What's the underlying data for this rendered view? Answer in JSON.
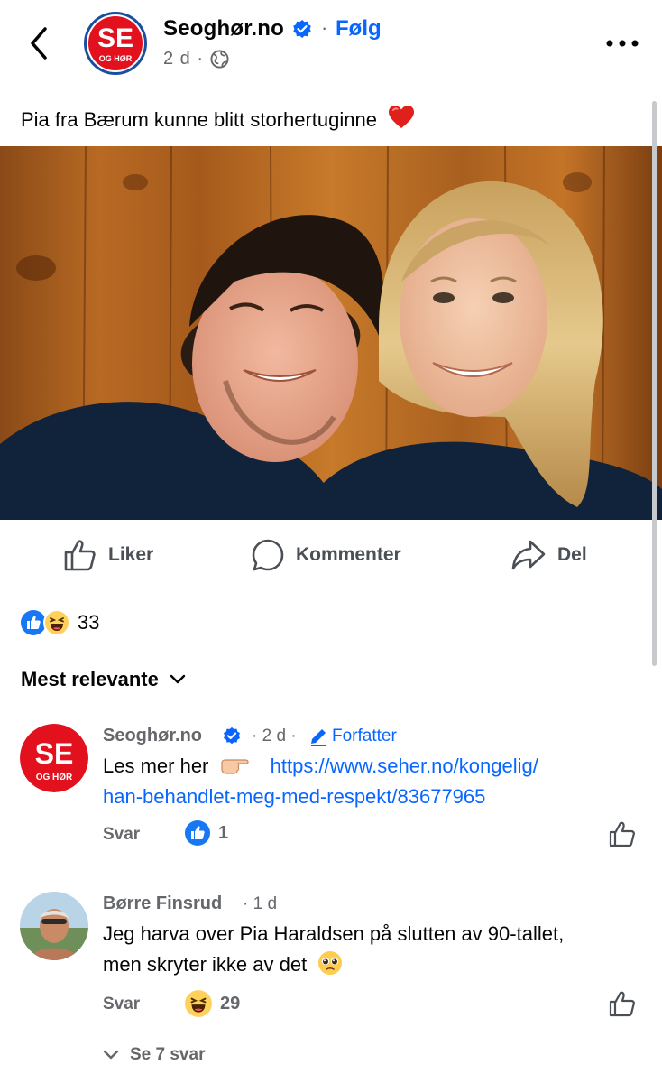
{
  "header": {
    "page_name": "Seoghør.no",
    "follow_label": "Følg",
    "dot_separator": "·",
    "time_meta": "2 d ·",
    "logo_text": "SE",
    "logo_sub": "OG HØR"
  },
  "post": {
    "caption": "Pia fra Bærum kunne blitt storhertuginne"
  },
  "actions": {
    "like_label": "Liker",
    "comment_label": "Kommenter",
    "share_label": "Del"
  },
  "reactions": {
    "count": "33"
  },
  "sort": {
    "label": "Mest relevante"
  },
  "comments": [
    {
      "author": "Seoghør.no",
      "meta": "· 2 d ·",
      "badge": "Forfatter",
      "text_prefix": "Les mer her",
      "link_line1": "https://www.seher.no/kongelig/",
      "link_line2": "han-behandlet-meg-med-respekt/83677965",
      "reply_label": "Svar",
      "reaction_count": "1"
    },
    {
      "author": "Børre Finsrud",
      "meta": "· 1 d",
      "text_line1": "Jeg harva over Pia Haraldsen på slutten av 90-tallet,",
      "text_line2": "men skryter ikke av det",
      "reply_label": "Svar",
      "reaction_count": "29"
    }
  ],
  "replies": {
    "label": "Se 7 svar"
  },
  "colors": {
    "brand_red": "#e3101d",
    "link_blue": "#0866ff",
    "meta_gray": "#65676b"
  }
}
